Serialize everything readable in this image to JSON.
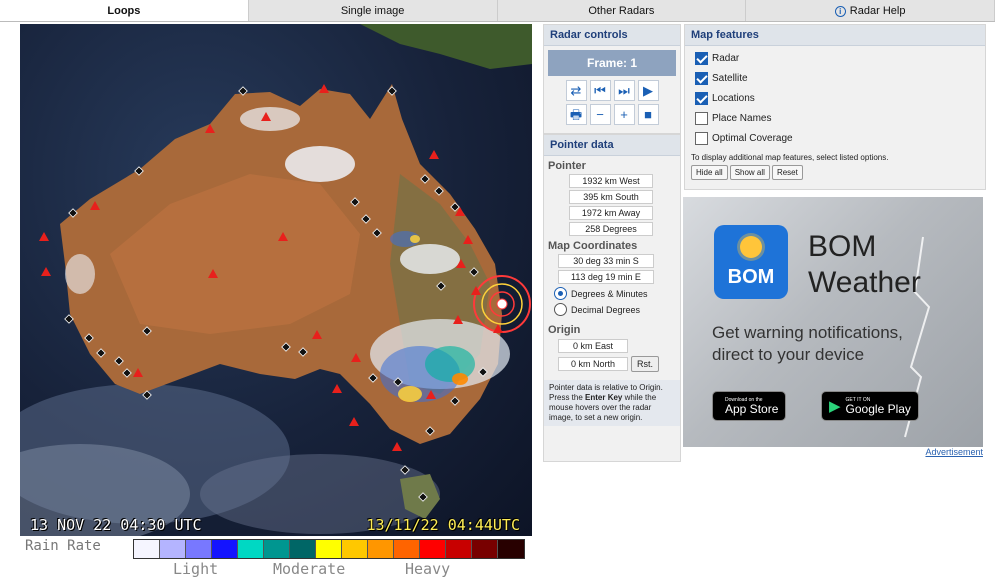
{
  "tabs": [
    {
      "label": "Loops",
      "active": true
    },
    {
      "label": "Single image",
      "active": false
    },
    {
      "label": "Other Radars",
      "active": false
    },
    {
      "label": "Radar Help",
      "active": false
    }
  ],
  "radar": {
    "timestamp_left": "13 NOV 22 04:30 UTC",
    "timestamp_right": "13/11/22 04:44UTC"
  },
  "rain_rate": {
    "label": "Rain Rate",
    "colors": [
      "#f5f5ff",
      "#b4b4ff",
      "#7878ff",
      "#1414ff",
      "#00d8c3",
      "#009690",
      "#006666",
      "#ffff00",
      "#ffc800",
      "#ff9600",
      "#ff6400",
      "#ff0000",
      "#c80000",
      "#780000",
      "#280000"
    ],
    "scale": [
      "Light",
      "Moderate",
      "Heavy"
    ]
  },
  "radar_controls": {
    "title": "Radar controls",
    "frame_label": "Frame: 1",
    "buttons_row1": [
      "⇄",
      "⏮",
      "⏭",
      "▶"
    ],
    "buttons_row2": [
      "🖶",
      "−",
      "+",
      "■"
    ]
  },
  "pointer_data": {
    "title": "Pointer data",
    "pointer_heading": "Pointer",
    "west": "1932 km West",
    "south": "395 km South",
    "away": "1972 km Away",
    "degrees": "258 Degrees",
    "map_coords_heading": "Map Coordinates",
    "lat": "30 deg 33 min S",
    "lon": "113 deg 19 min E",
    "opt_deg_min": "Degrees & Minutes",
    "opt_dec_deg": "Decimal Degrees",
    "origin_heading": "Origin",
    "origin_east": "0 km East",
    "origin_north": "0 km North",
    "reset_label": "Rst.",
    "note_pre": "Pointer data is relative to Origin. Press the ",
    "note_key": "Enter Key",
    "note_post": " while the mouse hovers over the radar image, to set a new origin."
  },
  "map_features": {
    "title": "Map features",
    "items": [
      {
        "label": "Radar",
        "checked": true
      },
      {
        "label": "Satellite",
        "checked": true
      },
      {
        "label": "Locations",
        "checked": true
      },
      {
        "label": "Place Names",
        "checked": false
      },
      {
        "label": "Optimal Coverage",
        "checked": false
      }
    ],
    "note": "To display additional map features, select listed options.",
    "hide_all": "Hide all",
    "show_all": "Show all",
    "reset": "Reset"
  },
  "ad": {
    "logo_text": "BOM",
    "brand_line1": "BOM",
    "brand_line2": "Weather",
    "copy_line1": "Get warning notifications,",
    "copy_line2": "direct to your device",
    "appstore_small": "Download on the",
    "appstore_large": "App Store",
    "play_small": "GET IT ON",
    "play_large": "Google Play",
    "link": "Advertisement"
  }
}
